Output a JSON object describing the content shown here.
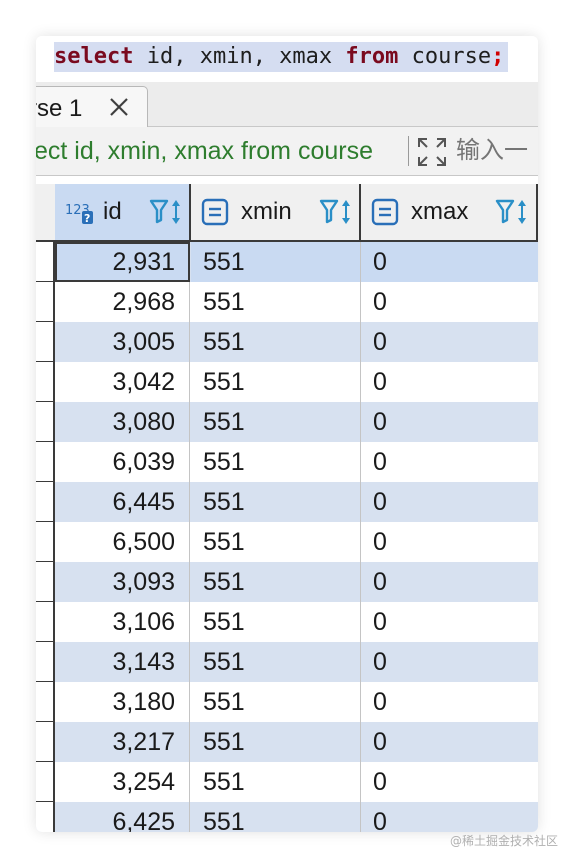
{
  "editor": {
    "sql": {
      "kw_select": "select",
      "cols": " id, xmin, xmax ",
      "kw_from": "from",
      "table": " course",
      "semicolon": ";"
    }
  },
  "result_tab": {
    "label": "rse 1"
  },
  "query_bar": {
    "query_text": "ect id, xmin, xmax from course",
    "filter_placeholder": "输入一"
  },
  "columns": [
    {
      "name": "id",
      "type_icon": "numeric-type-icon"
    },
    {
      "name": "xmin",
      "type_icon": "text-type-icon"
    },
    {
      "name": "xmax",
      "type_icon": "text-type-icon"
    }
  ],
  "rows": [
    {
      "id": "2,931",
      "xmin": "551",
      "xmax": "0"
    },
    {
      "id": "2,968",
      "xmin": "551",
      "xmax": "0"
    },
    {
      "id": "3,005",
      "xmin": "551",
      "xmax": "0"
    },
    {
      "id": "3,042",
      "xmin": "551",
      "xmax": "0"
    },
    {
      "id": "3,080",
      "xmin": "551",
      "xmax": "0"
    },
    {
      "id": "6,039",
      "xmin": "551",
      "xmax": "0"
    },
    {
      "id": "6,445",
      "xmin": "551",
      "xmax": "0"
    },
    {
      "id": "6,500",
      "xmin": "551",
      "xmax": "0"
    },
    {
      "id": "3,093",
      "xmin": "551",
      "xmax": "0"
    },
    {
      "id": "3,106",
      "xmin": "551",
      "xmax": "0"
    },
    {
      "id": "3,143",
      "xmin": "551",
      "xmax": "0"
    },
    {
      "id": "3,180",
      "xmin": "551",
      "xmax": "0"
    },
    {
      "id": "3,217",
      "xmin": "551",
      "xmax": "0"
    },
    {
      "id": "3,254",
      "xmin": "551",
      "xmax": "0"
    },
    {
      "id": "6,425",
      "xmin": "551",
      "xmax": "0"
    }
  ],
  "watermark": "@稀土掘金技术社区",
  "colors": {
    "keyword": "#7a0a1f",
    "query_text": "#2e7d2e",
    "selection": "#c9daf2",
    "row_stripe": "#d7e1f0"
  }
}
